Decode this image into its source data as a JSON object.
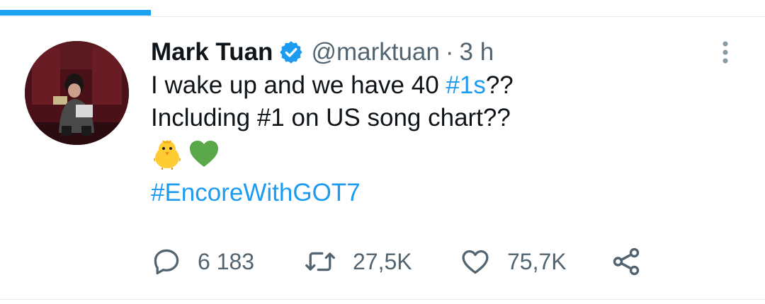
{
  "progress": {
    "fraction": 0.197
  },
  "tweet": {
    "display_name": "Mark Tuan",
    "handle": "@marktuan",
    "separator": "·",
    "time": "3 h",
    "line1_prefix": "I wake up and we have 40 ",
    "line1_hashtag": "#1s",
    "line1_suffix": "??",
    "line2": "Including #1 on US song chart??",
    "emojis": [
      "chick-emoji",
      "green-heart-emoji"
    ],
    "hashtag": "#EncoreWithGOT7"
  },
  "actions": {
    "replies": "6 183",
    "retweets": "27,5K",
    "likes": "75,7K"
  },
  "icons": {
    "verified": "verified-badge-icon",
    "more": "more-vertical-icon",
    "reply": "reply-icon",
    "retweet": "retweet-icon",
    "like": "heart-icon",
    "share": "share-icon"
  },
  "colors": {
    "accent": "#1d9bf0",
    "text": "#0f1419",
    "secondary": "#536471",
    "avatar_bg": "#3b0f14"
  }
}
